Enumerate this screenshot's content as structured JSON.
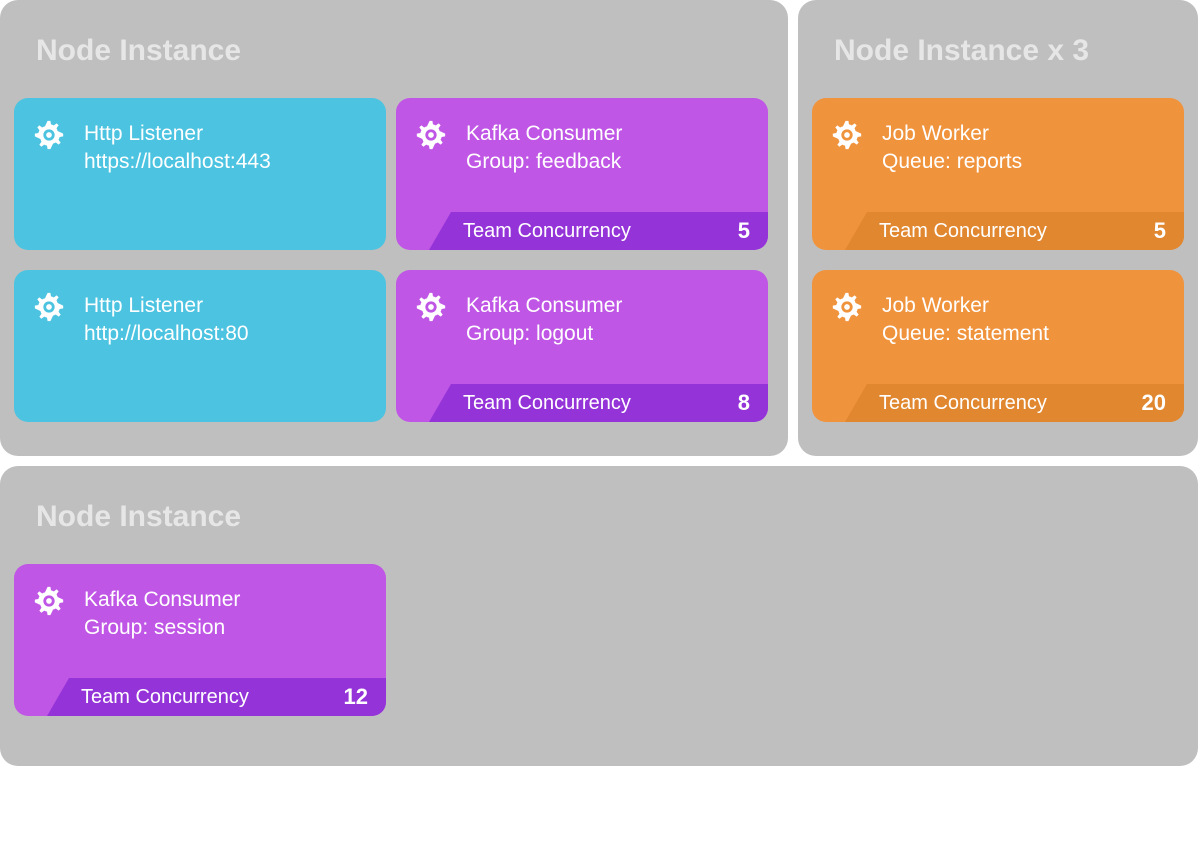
{
  "panels": {
    "p1": {
      "title": "Node Instance"
    },
    "p2": {
      "title": "Node Instance x 3"
    },
    "p3": {
      "title": "Node Instance"
    }
  },
  "concurrency_label": "Team Concurrency",
  "cards": {
    "http1": {
      "title": "Http Listener",
      "sub": "https://localhost:443"
    },
    "http2": {
      "title": "Http Listener",
      "sub": "http://localhost:80"
    },
    "kafka1": {
      "title": "Kafka Consumer",
      "sub": "Group: feedback",
      "concurrency": "5"
    },
    "kafka2": {
      "title": "Kafka Consumer",
      "sub": "Group: logout",
      "concurrency": "8"
    },
    "kafka3": {
      "title": "Kafka Consumer",
      "sub": "Group: session",
      "concurrency": "12"
    },
    "job1": {
      "title": "Job Worker",
      "sub": "Queue: reports",
      "concurrency": "5"
    },
    "job2": {
      "title": "Job Worker",
      "sub": "Queue: statement",
      "concurrency": "20"
    }
  }
}
